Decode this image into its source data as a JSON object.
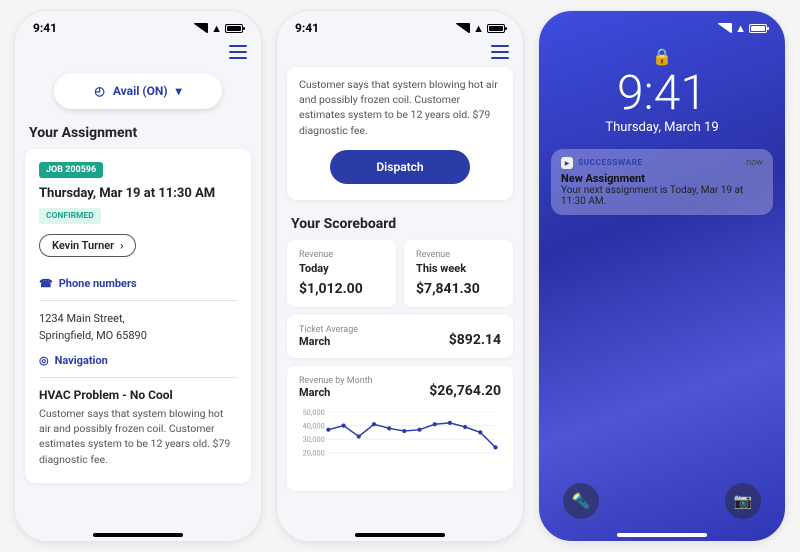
{
  "status_time": "9:41",
  "screen1": {
    "avail_label": "Avail (ON)",
    "section_title": "Your Assignment",
    "job_badge": "JOB 200596",
    "date": "Thursday, Mar 19 at 11:30 AM",
    "status": "CONFIRMED",
    "customer_name": "Kevin Turner",
    "phone_link": "Phone numbers",
    "address_line1": "1234 Main Street,",
    "address_line2": "Springfield, MO 65890",
    "nav_link": "Navigation",
    "issue_title": "HVAC Problem - No Cool",
    "issue_body": "Customer says that system blowing hot air and possibly frozen coil.\nCustomer estimates system to be 12 years old. $79 diagnostic fee."
  },
  "screen2": {
    "truncated_body": "Customer says that system blowing hot air and possibly frozen coil.\nCustomer estimates system to be 12 years old. $79 diagnostic fee.",
    "dispatch_label": "Dispatch",
    "section_title": "Your Scoreboard",
    "cards": {
      "today": {
        "small": "Revenue",
        "label": "Today",
        "val": "$1,012.00"
      },
      "week": {
        "small": "Revenue",
        "label": "This week",
        "val": "$7,841.30"
      },
      "ticket": {
        "small": "Ticket Average",
        "label": "March",
        "val": "$892.14"
      },
      "month": {
        "small": "Revenue by Month",
        "label": "March",
        "val": "$26,764.20"
      }
    }
  },
  "screen3": {
    "time": "9:41",
    "date": "Thursday, March 19",
    "notif_app": "SUCCESSWARE",
    "notif_when": "now",
    "notif_title": "New Assignment",
    "notif_body": "Your next assignment is Today, Mar 19 at 11:30 AM."
  },
  "chart_data": {
    "type": "line",
    "title": "Revenue by Month",
    "ylabel": "",
    "ylim": [
      0,
      50000
    ],
    "yticks": [
      50000,
      40000,
      30000,
      20000
    ],
    "x": [
      1,
      2,
      3,
      4,
      5,
      6,
      7,
      8,
      9,
      10,
      11,
      12
    ],
    "values": [
      37000,
      40000,
      32000,
      41000,
      38000,
      36000,
      37000,
      41000,
      42000,
      39000,
      35000,
      24000
    ]
  }
}
